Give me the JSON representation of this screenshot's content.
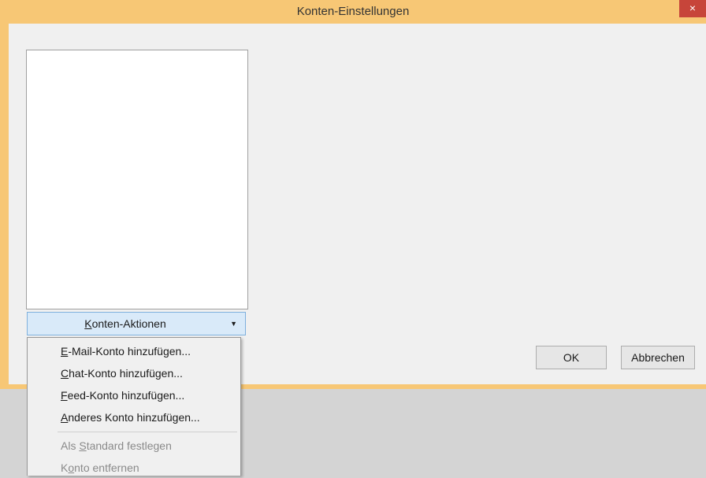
{
  "window": {
    "title": "Konten-Einstellungen",
    "close_glyph": "×"
  },
  "account_actions": {
    "label": "Konten-Aktionen",
    "mnemonic": "K",
    "label_rest": "onten-Aktionen",
    "arrow": "▼"
  },
  "buttons": {
    "ok": "OK",
    "cancel": "Abbrechen"
  },
  "menu": {
    "items": [
      {
        "label": "E-Mail-Konto hinzufügen...",
        "mnemonic": "E",
        "rest": "-Mail-Konto hinzufügen...",
        "enabled": true
      },
      {
        "label": "Chat-Konto hinzufügen...",
        "mnemonic": "C",
        "rest": "hat-Konto hinzufügen...",
        "enabled": true
      },
      {
        "label": "Feed-Konto hinzufügen...",
        "mnemonic": "F",
        "rest": "eed-Konto hinzufügen...",
        "enabled": true
      },
      {
        "label": "Anderes Konto hinzufügen...",
        "mnemonic": "A",
        "rest": "nderes Konto hinzufügen...",
        "enabled": true
      },
      {
        "label": "Als Standard festlegen",
        "pre": "Als ",
        "mnemonic": "S",
        "rest": "tandard festlegen",
        "enabled": false
      },
      {
        "label": "Konto entfernen",
        "pre": "K",
        "mnemonic": "o",
        "rest": "nto entfernen",
        "enabled": false
      }
    ]
  },
  "colors": {
    "frame": "#f7c775",
    "close": "#c7453a",
    "split_button": "#d9eaf9"
  }
}
